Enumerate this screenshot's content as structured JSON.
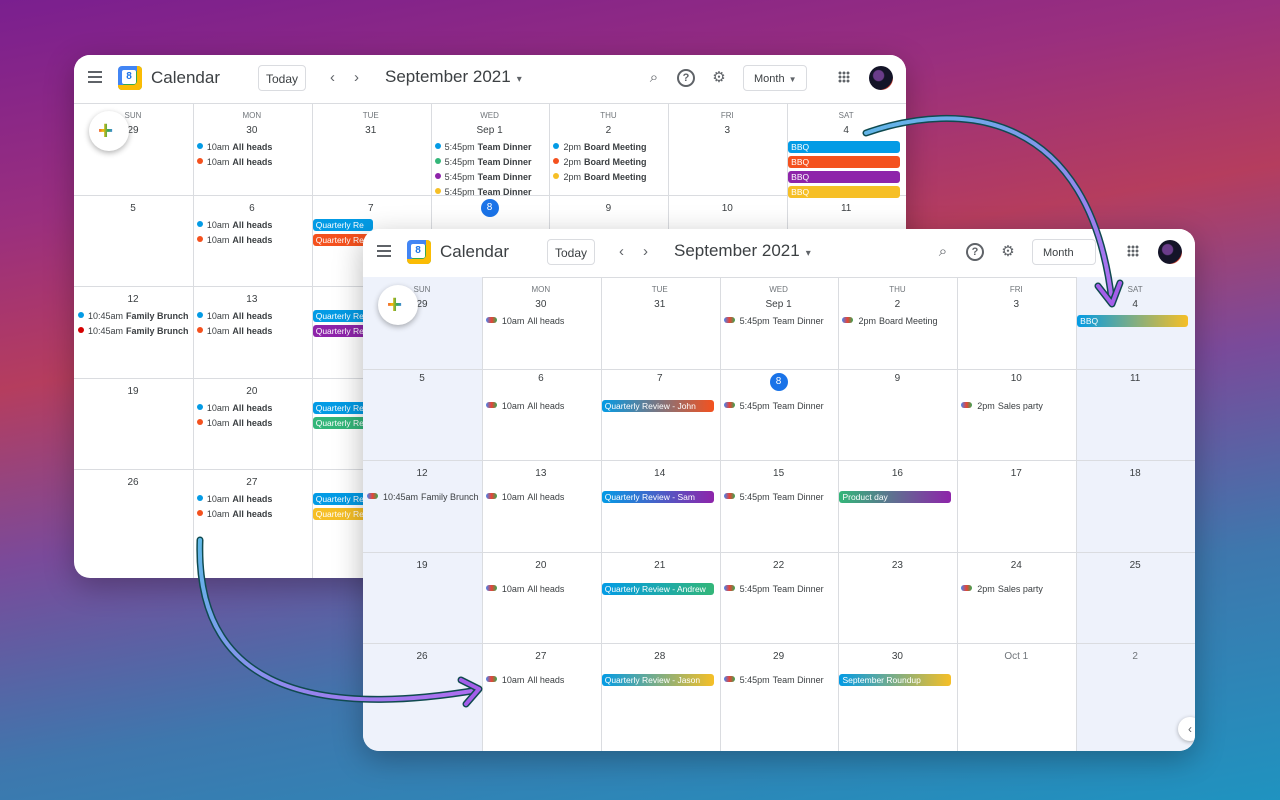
{
  "colors": {
    "blue": "#1a73e8",
    "red": "#f4511e",
    "green": "#33b679",
    "purple": "#8e24aa",
    "yellow": "#f6bf26",
    "arrow": "#a45eea"
  },
  "window_back": {
    "app_name": "Calendar",
    "logo_number": "8",
    "today_label": "Today",
    "month_title": "September 2021",
    "view_label": "Month",
    "icons": [
      "menu-icon",
      "prev-icon",
      "next-icon",
      "search-icon",
      "help-icon",
      "settings-icon",
      "apps-icon",
      "avatar"
    ],
    "day_names": [
      "SUN",
      "MON",
      "TUE",
      "WED",
      "THU",
      "FRI",
      "SAT"
    ],
    "weeks": [
      [
        "29",
        "30",
        "31",
        "Sep 1",
        "2",
        "3",
        "4"
      ],
      [
        "5",
        "6",
        "7",
        "8",
        "9",
        "10",
        "11"
      ],
      [
        "12",
        "13",
        "",
        "",
        "",
        "",
        ""
      ],
      [
        "19",
        "20",
        "",
        "",
        "",
        "",
        ""
      ],
      [
        "26",
        "27",
        "",
        "",
        "",
        "",
        ""
      ]
    ],
    "events": {
      "mon30": [
        {
          "time": "10am",
          "title": "All heads",
          "color": "#039be5"
        },
        {
          "time": "10am",
          "title": "All heads",
          "color": "#f4511e"
        }
      ],
      "wed1": [
        {
          "time": "5:45pm",
          "title": "Team Dinner",
          "color": "#039be5"
        },
        {
          "time": "5:45pm",
          "title": "Team Dinner",
          "color": "#33b679"
        },
        {
          "time": "5:45pm",
          "title": "Team Dinner",
          "color": "#8e24aa"
        },
        {
          "time": "5:45pm",
          "title": "Team Dinner",
          "color": "#f6bf26"
        }
      ],
      "thu2": [
        {
          "time": "2pm",
          "title": "Board Meeting",
          "color": "#039be5"
        },
        {
          "time": "2pm",
          "title": "Board Meeting",
          "color": "#f4511e"
        },
        {
          "time": "2pm",
          "title": "Board Meeting",
          "color": "#f6bf26"
        }
      ],
      "sat4": [
        {
          "title": "BBQ",
          "color": "#039be5"
        },
        {
          "title": "BBQ",
          "color": "#f4511e"
        },
        {
          "title": "BBQ",
          "color": "#8e24aa"
        },
        {
          "title": "BBQ",
          "color": "#f6bf26"
        }
      ],
      "mon6": [
        {
          "time": "10am",
          "title": "All heads",
          "color": "#039be5"
        },
        {
          "time": "10am",
          "title": "All heads",
          "color": "#f4511e"
        }
      ],
      "tue7": [
        {
          "title": "Quarterly Re",
          "color": "#039be5"
        },
        {
          "title": "Quarterly Re",
          "color": "#f4511e"
        }
      ],
      "sun12": [
        {
          "time": "10:45am",
          "title": "Family Brunch",
          "color": "#039be5"
        },
        {
          "time": "10:45am",
          "title": "Family Brunch",
          "color": "#d50000"
        }
      ],
      "mon13": [
        {
          "time": "10am",
          "title": "All heads",
          "color": "#039be5"
        },
        {
          "time": "10am",
          "title": "All heads",
          "color": "#f4511e"
        }
      ],
      "tue14": [
        {
          "title": "Quarterly Re",
          "color": "#039be5"
        },
        {
          "title": "Quarterly Re",
          "color": "#8e24aa"
        }
      ],
      "mon20": [
        {
          "time": "10am",
          "title": "All heads",
          "color": "#039be5"
        },
        {
          "time": "10am",
          "title": "All heads",
          "color": "#f4511e"
        }
      ],
      "tue21": [
        {
          "title": "Quarterly Re",
          "color": "#039be5"
        },
        {
          "title": "Quarterly Re",
          "color": "#33b679"
        }
      ],
      "mon27": [
        {
          "time": "10am",
          "title": "All heads",
          "color": "#039be5"
        },
        {
          "time": "10am",
          "title": "All heads",
          "color": "#f4511e"
        }
      ],
      "tue28": [
        {
          "title": "Quarterly Re",
          "color": "#039be5"
        },
        {
          "title": "Quarterly Re",
          "color": "#f6bf26"
        }
      ]
    }
  },
  "window_front": {
    "app_name": "Calendar",
    "logo_number": "8",
    "today_label": "Today",
    "month_title": "September 2021",
    "view_label": "Month",
    "day_names": [
      "SUN",
      "MON",
      "TUE",
      "WED",
      "THU",
      "FRI",
      "SAT"
    ],
    "weeks": [
      [
        "29",
        "30",
        "31",
        "Sep 1",
        "2",
        "3",
        "4"
      ],
      [
        "5",
        "6",
        "7",
        "8",
        "9",
        "10",
        "11"
      ],
      [
        "12",
        "13",
        "14",
        "15",
        "16",
        "17",
        "18"
      ],
      [
        "19",
        "20",
        "21",
        "22",
        "23",
        "24",
        "25"
      ],
      [
        "26",
        "27",
        "28",
        "29",
        "30",
        "Oct 1",
        "2"
      ]
    ],
    "dot_events": [
      {
        "cell": "1-0",
        "time": "10am",
        "title": "All heads"
      },
      {
        "cell": "3-0",
        "time": "5:45pm",
        "title": "Team Dinner"
      },
      {
        "cell": "4-0",
        "time": "2pm",
        "title": "Board Meeting"
      },
      {
        "cell": "1-1",
        "time": "10am",
        "title": "All heads"
      },
      {
        "cell": "3-1",
        "time": "5:45pm",
        "title": "Team Dinner"
      },
      {
        "cell": "5-1",
        "time": "2pm",
        "title": "Sales party"
      },
      {
        "cell": "0-2",
        "time": "10:45am",
        "title": "Family Brunch"
      },
      {
        "cell": "1-2",
        "time": "10am",
        "title": "All heads"
      },
      {
        "cell": "3-2",
        "time": "5:45pm",
        "title": "Team Dinner"
      },
      {
        "cell": "1-3",
        "time": "10am",
        "title": "All heads"
      },
      {
        "cell": "3-3",
        "time": "5:45pm",
        "title": "Team Dinner"
      },
      {
        "cell": "5-3",
        "time": "2pm",
        "title": "Sales party"
      },
      {
        "cell": "1-4",
        "time": "10am",
        "title": "All heads"
      },
      {
        "cell": "3-4",
        "time": "5:45pm",
        "title": "Team Dinner"
      }
    ],
    "chips": [
      {
        "cell": "6-0",
        "title": "BBQ",
        "from": "#039be5",
        "to": "#f6bf26"
      },
      {
        "cell": "2-1",
        "title": "Quarterly Review - John",
        "from": "#039be5",
        "to": "#f4511e"
      },
      {
        "cell": "2-2",
        "title": "Quarterly Review - Sam",
        "from": "#039be5",
        "to": "#8e24aa"
      },
      {
        "cell": "4-2",
        "title": "Product day",
        "from": "#33b679",
        "to": "#8e24aa"
      },
      {
        "cell": "2-3",
        "title": "Quarterly Review - Andrew",
        "from": "#039be5",
        "to": "#33b679"
      },
      {
        "cell": "2-4",
        "title": "Quarterly Review - Jason",
        "from": "#039be5",
        "to": "#f6bf26"
      },
      {
        "cell": "4-4",
        "title": "September Roundup",
        "from": "#039be5",
        "to": "#f6bf26"
      }
    ]
  }
}
